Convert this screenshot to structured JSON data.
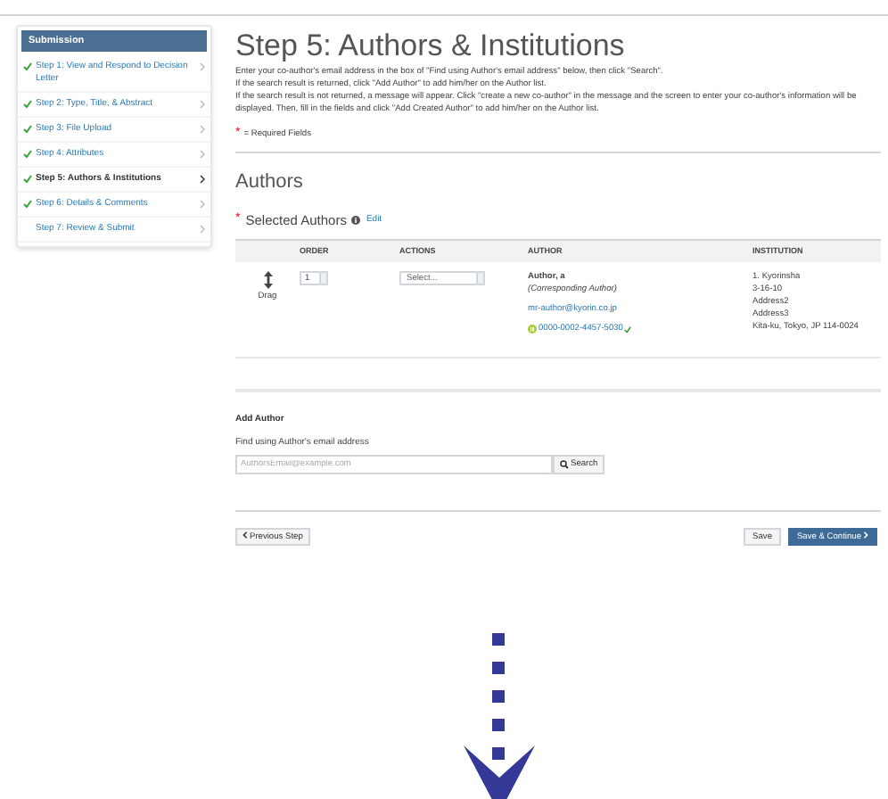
{
  "sidebar": {
    "title": "Submission",
    "items": [
      {
        "label": "Step 1: View and Respond to Decision Letter",
        "checked": true,
        "selected": false
      },
      {
        "label": "Step 2: Type, Title, & Abstract",
        "checked": true,
        "selected": false
      },
      {
        "label": "Step 3: File Upload",
        "checked": true,
        "selected": false
      },
      {
        "label": "Step 4: Attributes",
        "checked": true,
        "selected": false
      },
      {
        "label": "Step 5: Authors & Institutions",
        "checked": true,
        "selected": true
      },
      {
        "label": "Step 6: Details & Comments",
        "checked": true,
        "selected": false
      },
      {
        "label": "Step 7: Review & Submit",
        "checked": false,
        "selected": false
      }
    ]
  },
  "page_title": "Step 5: Authors & Institutions",
  "instructions": [
    "Enter your co-author's email address in the box of \"Find using Author's email address\" below, then click \"Search\".",
    "If the search result is returned, click \"Add Author\" to add him/her on the Author list.",
    "If the search result is not returned, a message will appear. Click \"create a new co-author\" in the message and the screen to enter your co-author's information will be displayed. Then, fill in the fields and click \"Add Created Author\" to add him/her on the Author list."
  ],
  "required_note": {
    "mark": "*",
    "text": "= Required Fields"
  },
  "authors_heading": "Authors",
  "selected_authors": {
    "mark": "*",
    "label": "Selected Authors",
    "edit": "Edit"
  },
  "table": {
    "columns": [
      "ORDER",
      "ACTIONS",
      "AUTHOR",
      "INSTITUTION"
    ],
    "rows": [
      {
        "drag": "Drag",
        "order": "1",
        "action": "Select...",
        "name": "Author, a",
        "role": "(Corresponding Author)",
        "email": "mr-author@kyorin.co.jp",
        "orcid": "0000-0002-4457-5030",
        "orcid_verified": true,
        "institution": [
          "1. Kyorinsha",
          "3-16-10",
          "Address2",
          "Address3",
          "Kita-ku, Tokyo, JP 114-0024"
        ]
      }
    ]
  },
  "add_author": {
    "heading": "Add Author",
    "label": "Find using Author's email address",
    "placeholder": "AuthorsEmail@example.com",
    "search": "Search"
  },
  "buttons": {
    "previous": "Previous Step",
    "save": "Save",
    "save_continue": "Save & Continue"
  }
}
